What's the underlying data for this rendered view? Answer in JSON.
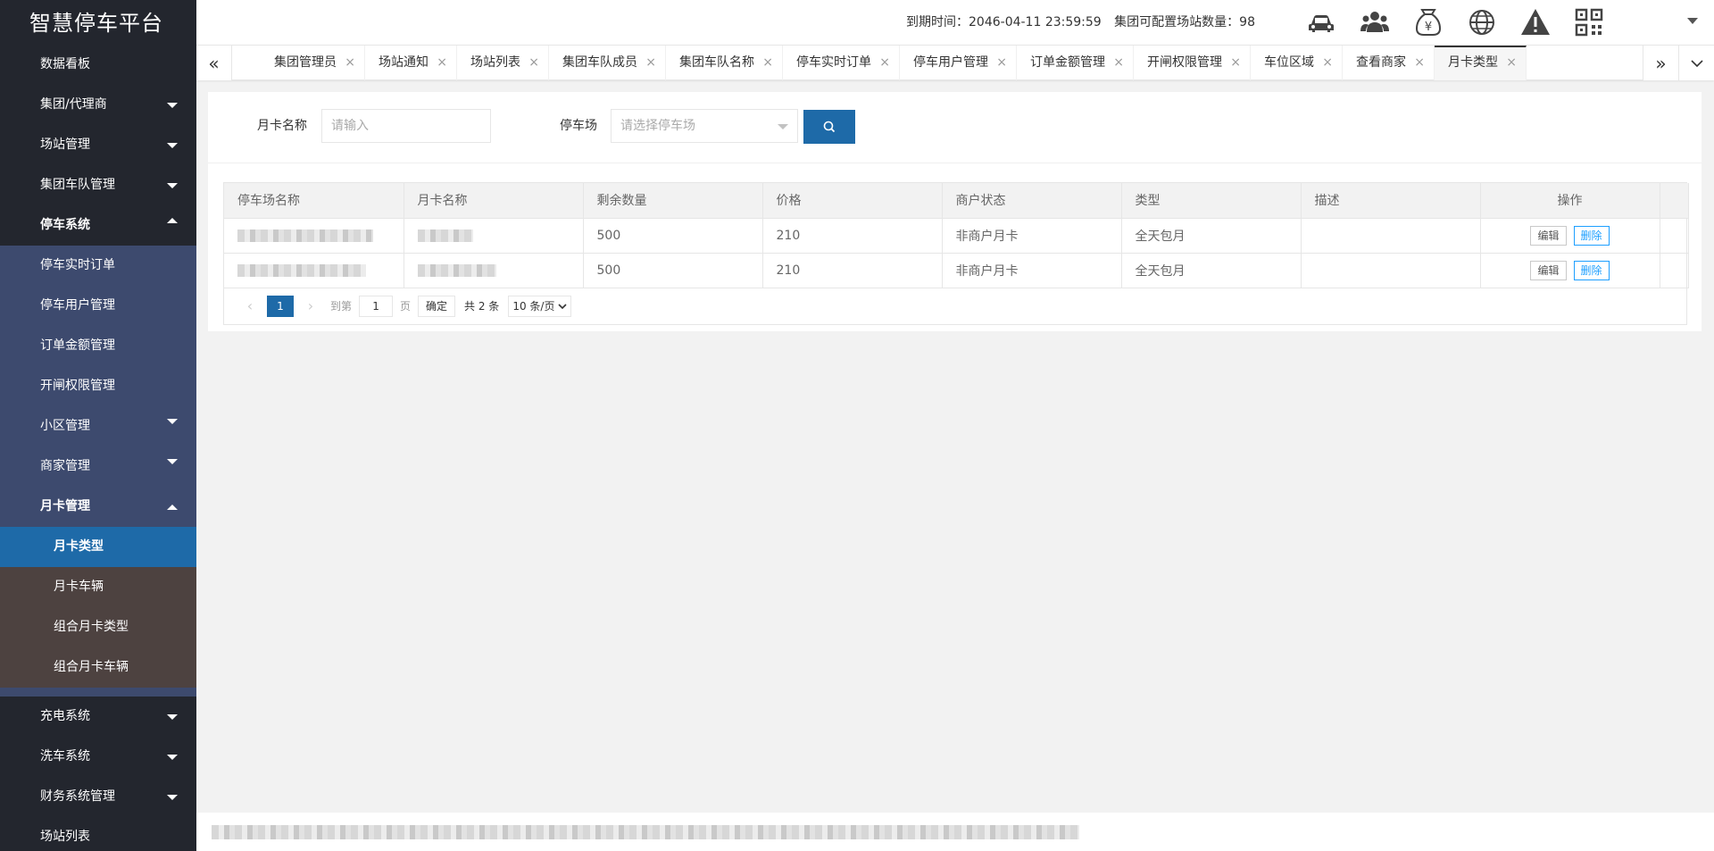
{
  "app": {
    "title": "智慧停车平台"
  },
  "sidebar": {
    "items": [
      {
        "label": "数据看板"
      },
      {
        "label": "集团/代理商"
      },
      {
        "label": "场站管理"
      },
      {
        "label": "集团车队管理"
      },
      {
        "label": "停车系统"
      },
      {
        "label": "停车实时订单"
      },
      {
        "label": "停车用户管理"
      },
      {
        "label": "订单金额管理"
      },
      {
        "label": "开闸权限管理"
      },
      {
        "label": "小区管理"
      },
      {
        "label": "商家管理"
      },
      {
        "label": "月卡管理"
      },
      {
        "label": "月卡类型"
      },
      {
        "label": "月卡车辆"
      },
      {
        "label": "组合月卡类型"
      },
      {
        "label": "组合月卡车辆"
      },
      {
        "label": "充电系统"
      },
      {
        "label": "洗车系统"
      },
      {
        "label": "财务系统管理"
      },
      {
        "label": "场站列表"
      }
    ]
  },
  "topbar": {
    "expire_text": "到期时间：2046-04-11 23:59:59",
    "station_text": "集团可配置场站数量：98",
    "icons": [
      "car-icon",
      "users-icon",
      "money-bag-icon",
      "globe-icon",
      "warning-icon",
      "qrcode-icon"
    ]
  },
  "tabs": [
    {
      "label": "集团管理员"
    },
    {
      "label": "场站通知"
    },
    {
      "label": "场站列表"
    },
    {
      "label": "集团车队成员"
    },
    {
      "label": "集团车队名称"
    },
    {
      "label": "停车实时订单"
    },
    {
      "label": "停车用户管理"
    },
    {
      "label": "订单金额管理"
    },
    {
      "label": "开闸权限管理"
    },
    {
      "label": "车位区域"
    },
    {
      "label": "查看商家"
    },
    {
      "label": "月卡类型"
    }
  ],
  "tab_close": "×",
  "search": {
    "card_name_label": "月卡名称",
    "card_name_placeholder": "请输入",
    "parking_label": "停车场",
    "parking_placeholder": "请选择停车场"
  },
  "table": {
    "headers": [
      "停车场名称",
      "月卡名称",
      "剩余数量",
      "价格",
      "商户状态",
      "类型",
      "描述",
      "操作"
    ],
    "rows": [
      {
        "remaining": "500",
        "price": "210",
        "merchant_status": "非商户月卡",
        "type": "全天包月",
        "desc": ""
      },
      {
        "remaining": "500",
        "price": "210",
        "merchant_status": "非商户月卡",
        "type": "全天包月",
        "desc": ""
      }
    ],
    "edit_label": "编辑",
    "delete_label": "删除"
  },
  "pagination": {
    "current": "1",
    "goto_label": "到第",
    "page_input": "1",
    "page_unit": "页",
    "confirm": "确定",
    "total": "共 2 条",
    "page_size": "10 条/页"
  }
}
